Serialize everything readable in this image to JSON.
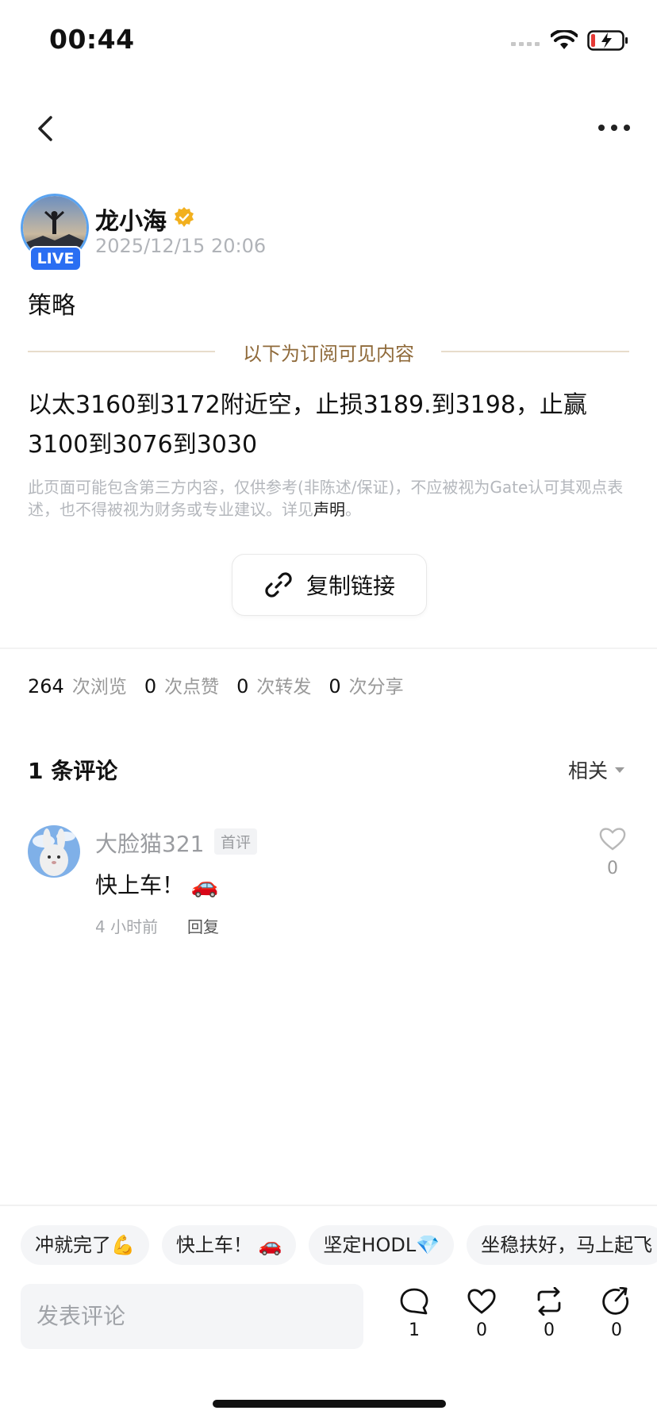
{
  "status_bar": {
    "time": "00:44"
  },
  "post": {
    "author": "龙小海",
    "live_badge": "LIVE",
    "timestamp": "2025/12/15 20:06",
    "title": "策略",
    "subscriber_divider": "以下为订阅可见内容",
    "body": "以太3160到3172附近空，止损3189.到3198，止赢3100到3076到3030",
    "disclaimer": "此页面可能包含第三方内容，仅供参考(非陈述/保证)，不应被视为Gate认可其观点表述，也不得被视为财务或专业建议。详见",
    "disclaimer_link": "声明",
    "disclaimer_end": "。",
    "copy_link_label": "复制链接"
  },
  "stats": {
    "views": "264",
    "views_label": "次浏览",
    "likes": "0",
    "likes_label": "次点赞",
    "reposts": "0",
    "reposts_label": "次转发",
    "shares": "0",
    "shares_label": "次分享"
  },
  "comments": {
    "header": "1 条评论",
    "sort_label": "相关",
    "items": [
      {
        "user": "大脸猫321",
        "tag": "首评",
        "text": "快上车！ 🚗",
        "time": "4 小时前",
        "reply_label": "回复",
        "likes": "0"
      }
    ]
  },
  "quick_replies": [
    "冲就完了💪",
    "快上车！ 🚗",
    "坚定HODL💎",
    "坐稳扶好，马上起飞"
  ],
  "footer": {
    "input_placeholder": "发表评论",
    "comment_count": "1",
    "like_count": "0",
    "repost_count": "0",
    "share_count": "0"
  },
  "colors": {
    "live_badge": "#2a6ef2",
    "subscriber_divider_text": "#8f6a3a",
    "verified_badge": "#f2b01e"
  }
}
